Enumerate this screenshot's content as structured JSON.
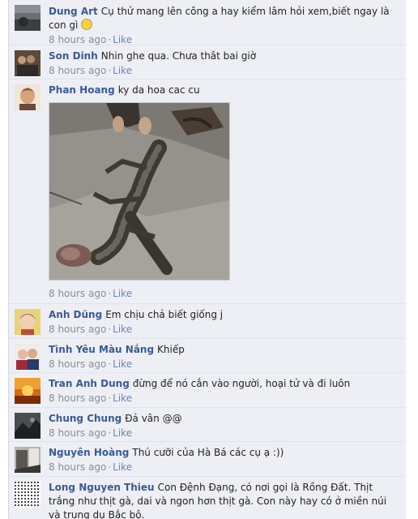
{
  "comments": [
    {
      "author": "Dung Art",
      "text": "Cụ thử mang lên công a hay kiểm lâm hỏi xem,biết ngay là con gì",
      "emoji": "confused-face-emoji",
      "time": "8 hours ago",
      "like": "Like",
      "avatar": "dark-landscape"
    },
    {
      "author": "Son Dinh",
      "text": "Nhin ghe qua. Chưa thât bai giờ",
      "time": "8 hours ago",
      "like": "Like",
      "avatar": "group-photo"
    },
    {
      "author": "Phan Hoang",
      "text": "ky da hoa cac cu",
      "time": "8 hours ago",
      "like": "Like",
      "avatar": "man-portrait",
      "photo": "monitor-lizard-photo"
    },
    {
      "author": "Anh Dũng",
      "text": "Em chịu chả biết giống j",
      "time": "8 hours ago",
      "like": "Like",
      "avatar": "child-portrait"
    },
    {
      "author": "Tình Yêu Màu Nắng",
      "text": "Khiếp",
      "time": "8 hours ago",
      "like": "Like",
      "avatar": "two-people"
    },
    {
      "author": "Tran Anh Dung",
      "text": "đừng để nó cắn vào người, hoại tử và đi luôn",
      "time": "8 hours ago",
      "like": "Like",
      "avatar": "sunset-logo"
    },
    {
      "author": "Chung Chung",
      "text": "Đả vân @@",
      "time": "8 hours ago",
      "like": "Like",
      "avatar": "dark-figure"
    },
    {
      "author": "Nguyên Hoàng",
      "text": "Thú cưỡi của Hà Bá các cụ ạ :))",
      "time": "8 hours ago",
      "like": "Like",
      "avatar": "street-photo"
    },
    {
      "author": "Long Nguyen Thieu",
      "text": "Con Đệnh Đạng, có nơi gọi là Rồng Đất. Thịt trắng như thịt gà, dai và ngon hơn thịt gà. Con này hay có ở miền núi và trung du Bắc bộ.",
      "time": "",
      "like": "",
      "avatar": "dotted-pattern"
    }
  ]
}
